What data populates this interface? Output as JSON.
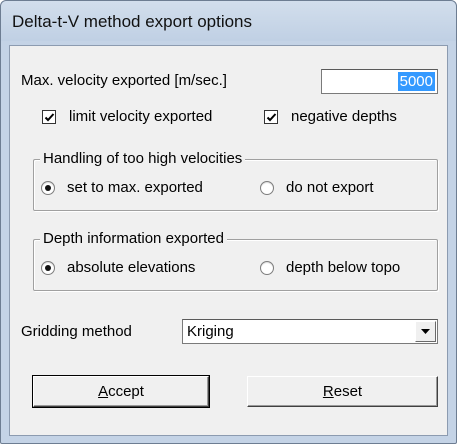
{
  "window": {
    "title": "Delta-t-V method export options"
  },
  "max_velocity": {
    "label": "Max. velocity exported [m/sec.]",
    "value": "5000"
  },
  "checkboxes": {
    "limit_velocity": {
      "label": "limit velocity exported",
      "checked": true
    },
    "negative_depths": {
      "label": "negative depths",
      "checked": true
    }
  },
  "high_velocities": {
    "legend": "Handling of too high velocities",
    "options": [
      {
        "label": "set to max. exported",
        "selected": true
      },
      {
        "label": "do not export",
        "selected": false
      }
    ]
  },
  "depth_info": {
    "legend": "Depth information exported",
    "options": [
      {
        "label": "absolute elevations",
        "selected": true
      },
      {
        "label": "depth below topo",
        "selected": false
      }
    ]
  },
  "gridding": {
    "label": "Gridding method",
    "value": "Kriging"
  },
  "buttons": {
    "accept": {
      "mnemonic": "A",
      "rest": "ccept"
    },
    "reset": {
      "mnemonic": "R",
      "rest": "eset"
    }
  }
}
